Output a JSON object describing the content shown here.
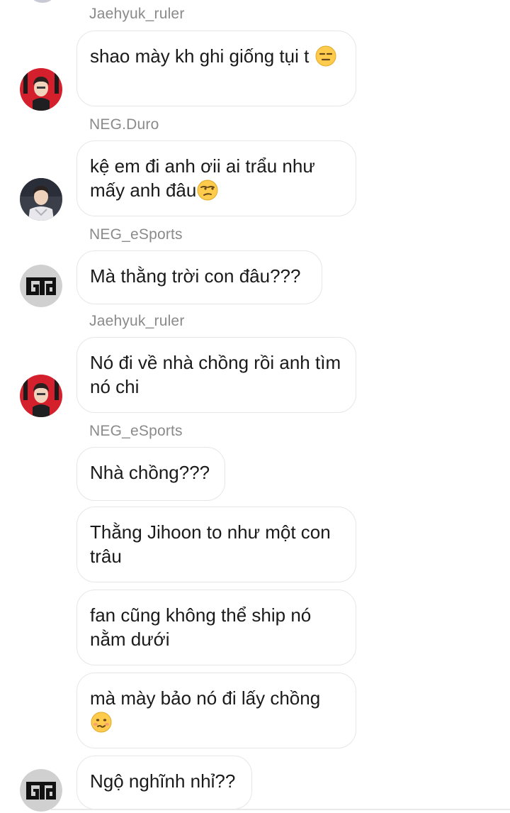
{
  "messages": [
    {
      "sender": "Jaehyuk_ruler",
      "text": "shao mày kh ghi giống tụi t",
      "emoji": "expressionless-face-icon"
    },
    {
      "sender": "NEG.Duro",
      "text": "kệ em đi anh ơii ai trẩu như mấy anh đâu",
      "emoji": "unamused-face-icon"
    },
    {
      "sender": "NEG_eSports",
      "text": "Mà thằng trời con đâu???"
    },
    {
      "sender": "Jaehyuk_ruler",
      "text": "Nó đi về nhà chồng rồi anh tìm nó chi"
    },
    {
      "sender": "NEG_eSports",
      "text": "Nhà chồng???"
    },
    {
      "text": "Thằng Jihoon to như một con trâu"
    },
    {
      "text": "fan cũng không thể ship nó nằm dưới"
    },
    {
      "text": "mà mày bảo nó đi lấy chồng",
      "emoji": "woozy-face-icon"
    },
    {
      "text": "Ngộ nghĩnh nhỉ??"
    }
  ],
  "avatars": {
    "jaehyuk": "avatar-red-player-photo",
    "duro": "avatar-player-photo",
    "neg": "avatar-gen-g-logo"
  },
  "colors": {
    "sender_name": "#8a8a8a",
    "bubble_border": "#e6e6e6",
    "avatar_red": "#d4202c",
    "logo_gray": "#d0d0d0"
  }
}
